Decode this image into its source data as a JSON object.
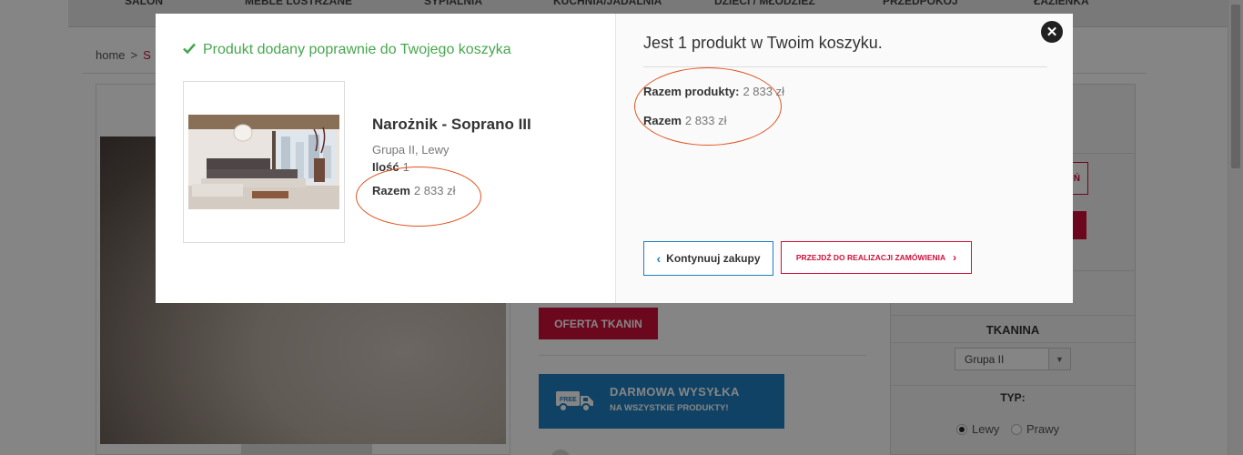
{
  "nav": {
    "items": [
      "SALON",
      "MEBLE LUSTRZANE",
      "SYPIALNIA",
      "KUCHNIA/JADALNIA",
      "DZIECI / MŁODZIEŻ",
      "PRZEDPOKÓJ",
      "ŁAZIENKA"
    ]
  },
  "breadcrumb": {
    "home": "home",
    "sep": ">",
    "current": "S"
  },
  "product_page": {
    "oferta_button": "OFERTA TKANIN",
    "shipping": {
      "title": "DARMOWA WYSYŁKA",
      "subtitle": "NA WSZYSTKIE PRODUKTY!"
    },
    "side": {
      "red_button_fragment": "Ń",
      "tkanina_label": "TKANINA",
      "select_value": "Grupa II",
      "typ_label": "TYP:",
      "radio_lewy": "Lewy",
      "radio_prawy": "Prawy"
    }
  },
  "modal": {
    "success_message": "Produkt dodany poprawnie do Twojego koszyka",
    "product": {
      "name": "Narożnik - Soprano III",
      "attributes": "Grupa II, Lewy",
      "qty_label": "Ilość",
      "qty_value": "1",
      "total_label": "Razem",
      "total_value": "2 833 zł"
    },
    "cart": {
      "title": "Jest 1 produkt w Twoim koszyku.",
      "subtotal_label": "Razem produkty:",
      "subtotal_value": "2 833 zł",
      "total_label": "Razem",
      "total_value": "2 833 zł"
    },
    "buttons": {
      "continue": "Kontynuuj zakupy",
      "checkout": "PRZEJDŹ DO REALIZACJI ZAMÓWIENIA"
    }
  },
  "icons": {
    "success": "check-icon",
    "close": "close-icon",
    "continue_chevron": "chevron-left-icon",
    "checkout_chevron": "chevron-right-icon",
    "shipping": "delivery-truck-icon"
  },
  "colors": {
    "success_green": "#46a74e",
    "brand_red": "#d0103a",
    "accent_blue": "#1d7fc2",
    "annotation_orange": "#e0521f"
  }
}
